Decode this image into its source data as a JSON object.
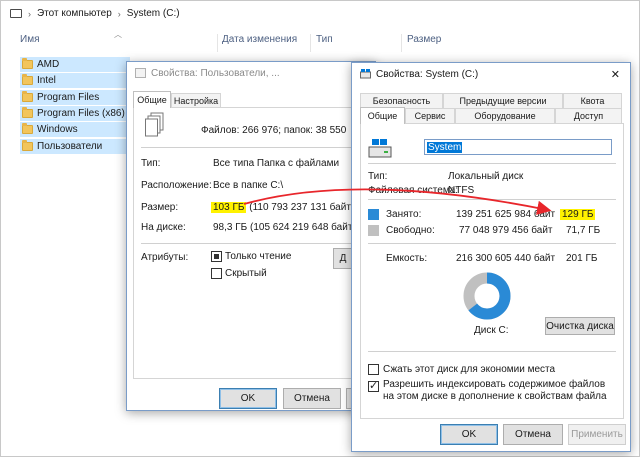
{
  "explorer": {
    "breadcrumb": [
      "Этот компьютер",
      "System (C:)"
    ],
    "columns": [
      "Имя",
      "Дата изменения",
      "Тип",
      "Размер"
    ],
    "folders": [
      "AMD",
      "Intel",
      "Program Files",
      "Program Files (x86)",
      "Windows",
      "Пользователи"
    ]
  },
  "dialog_users": {
    "title": "Свойства: Пользователи, ...",
    "tabs": [
      "Общие",
      "Настройка"
    ],
    "summary": "Файлов: 266 976; папок: 38 550",
    "type_label": "Тип:",
    "type_value": "Все типа Папка с файлами",
    "location_label": "Расположение:",
    "location_value": "Все в папке C:\\",
    "size_label": "Размер:",
    "size_value_hl": "103 ГБ",
    "size_value_rest": "(110 793 237 131 байт)",
    "disk_label": "На диске:",
    "disk_value": "98,3 ГБ (105 624 219 648 байт)",
    "attributes_label": "Атрибуты:",
    "readonly_label": "Только чтение",
    "hidden_label": "Скрытый",
    "partial_button": "Д",
    "ok": "OK",
    "cancel": "Отмена"
  },
  "dialog_system": {
    "title": "Свойства: System (C:)",
    "close": "✕",
    "tabs_row1": [
      "Безопасность",
      "Предыдущие версии",
      "Квота"
    ],
    "tabs_row2": [
      "Общие",
      "Сервис",
      "Оборудование",
      "Доступ"
    ],
    "name_value": "System",
    "type_label": "Тип:",
    "type_value": "Локальный диск",
    "fs_label": "Файловая система:",
    "fs_value": "NTFS",
    "used_label": "Занято:",
    "used_bytes": "139 251 625 984 байт",
    "used_gb": "129 ГБ",
    "free_label": "Свободно:",
    "free_bytes": "77 048 979 456 байт",
    "free_gb": "71,7 ГБ",
    "capacity_label": "Емкость:",
    "capacity_bytes": "216 300 605 440 байт",
    "capacity_gb": "201 ГБ",
    "disk_label": "Диск С:",
    "cleanup_button": "Очистка диска",
    "compress_label": "Сжать этот диск для экономии места",
    "index_label": "Разрешить индексировать содержимое файлов на этом диске в дополнение к свойствам файла",
    "ok": "OK",
    "cancel": "Отмена",
    "apply": "Применить",
    "used_fraction": 0.644
  },
  "colors": {
    "used": "#2a8ad6",
    "free": "#c0c0c0",
    "arrow": "#e8262b",
    "highlight": "#fff200",
    "selection": "#cce8ff"
  }
}
